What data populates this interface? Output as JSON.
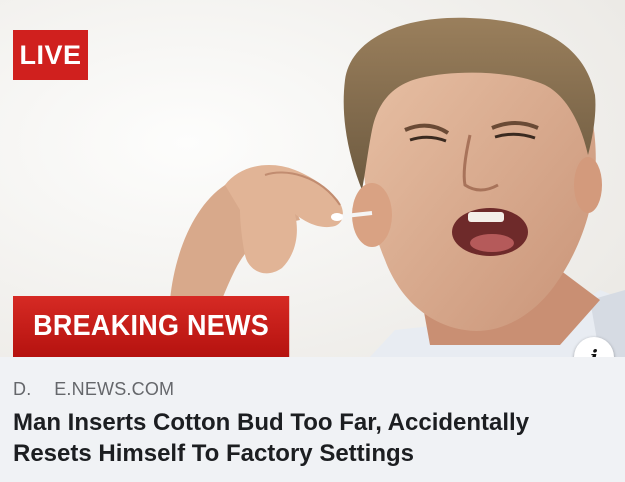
{
  "badges": {
    "live": "LIVE",
    "breaking": "BREAKING NEWS"
  },
  "info_icon": {
    "icon": "info-icon",
    "glyph": "i"
  },
  "link_preview": {
    "domain": "D.      E.NEWS.COM",
    "headline": "Man Inserts Cotton Bud Too Far, Accidentally Resets Himself To Factory Settings"
  },
  "colors": {
    "badge_red": "#d0201e",
    "caption_bg": "#f0f2f5",
    "domain_gray": "#65676b",
    "headline_text": "#1c1e21"
  }
}
